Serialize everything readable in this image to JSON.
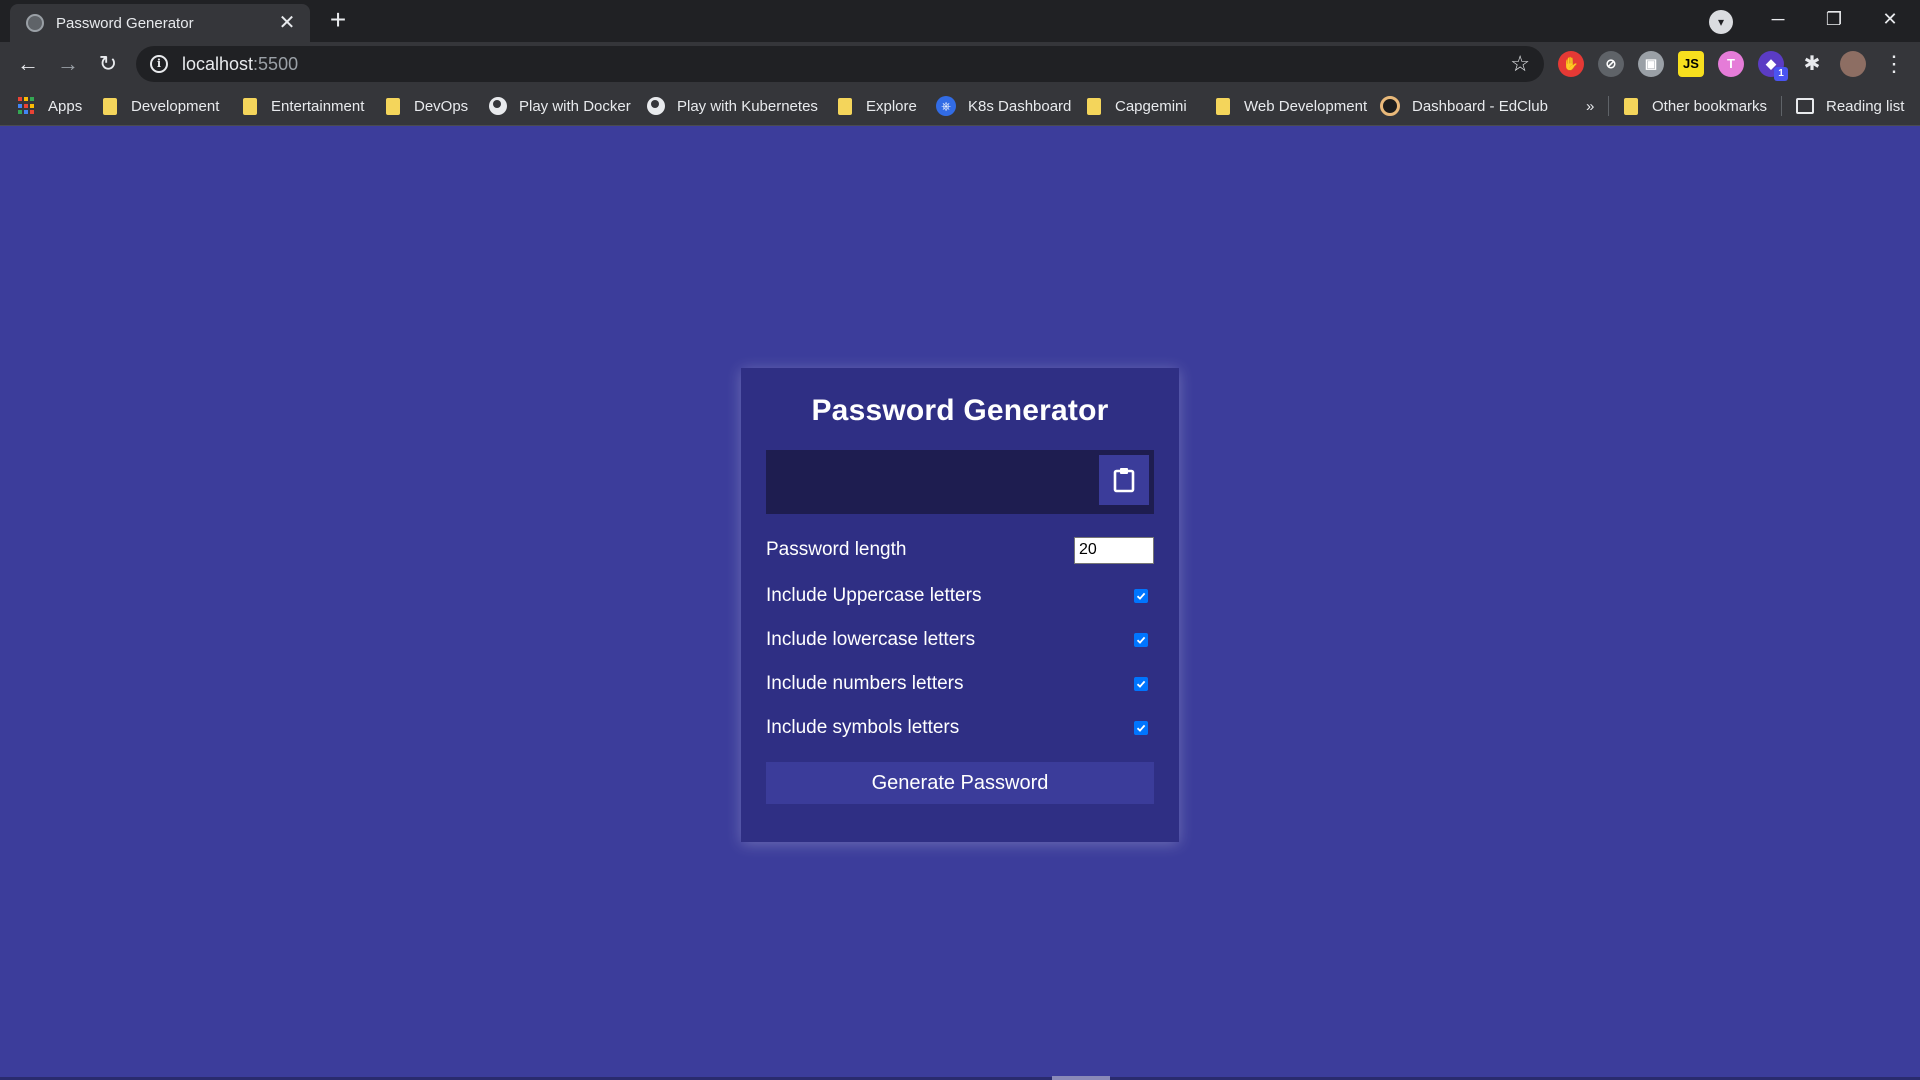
{
  "browser": {
    "tab_title": "Password Generator",
    "tab_close": "✕",
    "new_tab": "+",
    "url_host": "localhost",
    "url_port": ":5500",
    "back": "←",
    "forward": "→",
    "reload": "↻",
    "star": "☆",
    "window_min": "─",
    "window_max": "❐",
    "window_close": "✕",
    "menu": "⋮",
    "extensions": [
      {
        "name": "adblock",
        "color": "#e53935",
        "glyph": "✋"
      },
      {
        "name": "block",
        "color": "#5f6368",
        "glyph": "⊘"
      },
      {
        "name": "ext3",
        "color": "#9aa0a6",
        "glyph": "▣"
      },
      {
        "name": "js",
        "color": "#f7df1e",
        "glyph": "JS"
      },
      {
        "name": "toggl",
        "color": "#e57cd8",
        "glyph": "T"
      },
      {
        "name": "ext6",
        "color": "#5b3cc4",
        "glyph": "◆",
        "badge": "1"
      }
    ]
  },
  "bookmarks": [
    {
      "label": "Apps",
      "icon": "apps-icon"
    },
    {
      "label": "Development",
      "icon": "folder-icon"
    },
    {
      "label": "Entertainment",
      "icon": "folder-icon"
    },
    {
      "label": "DevOps",
      "icon": "folder-icon"
    },
    {
      "label": "Play with Docker",
      "icon": "globe-icon"
    },
    {
      "label": "Play with Kubernetes",
      "icon": "globe-icon"
    },
    {
      "label": "Explore",
      "icon": "folder-icon"
    },
    {
      "label": "K8s Dashboard",
      "icon": "k8s-icon"
    },
    {
      "label": "Capgemini",
      "icon": "folder-icon"
    },
    {
      "label": "Web Development",
      "icon": "folder-icon"
    },
    {
      "label": "Dashboard - EdClub",
      "icon": "edclub-icon"
    }
  ],
  "bookmarks_more": "»",
  "other_bookmarks": "Other bookmarks",
  "reading_list": "Reading list",
  "app": {
    "title": "Password Generator",
    "result": "",
    "length_label": "Password length",
    "length_value": "20",
    "options": [
      {
        "label": "Include Uppercase letters",
        "checked": true
      },
      {
        "label": "Include lowercase letters",
        "checked": true
      },
      {
        "label": "Include numbers letters",
        "checked": true
      },
      {
        "label": "Include symbols letters",
        "checked": true
      }
    ],
    "generate_label": "Generate Password"
  },
  "colors": {
    "page_bg": "#3c3d9b",
    "card_bg": "#2f2f84",
    "result_bg": "#1e1d50",
    "button_bg": "#3b3c9a",
    "checkbox": "#0075ff"
  }
}
